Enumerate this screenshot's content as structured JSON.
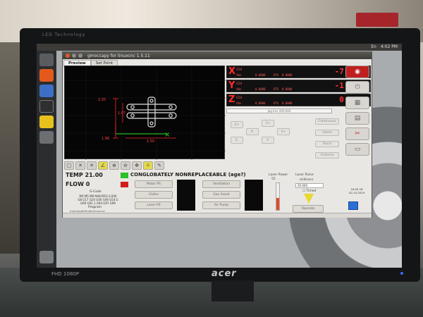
{
  "monitor": {
    "brand": "LED Technology",
    "logo": "acer",
    "badge": "FHD 1080P"
  },
  "topbar": {
    "tray": [
      "En",
      "4:02 PM"
    ]
  },
  "window": {
    "title": "gmoccapy for linuxcnc  1.5.11",
    "title_bar_label": "gmoccapy for linuxcnc  1.5.11"
  },
  "tabs": [
    "Preview",
    "Set Point"
  ],
  "preview": {
    "dim_y": "3.35",
    "dim_side": "1.07",
    "dim_bottom_left": "1.96",
    "dim_bottom": "1.50"
  },
  "dro": {
    "coord_label": "G54",
    "abs_label": "Abs",
    "dtg_label": "DTG",
    "axes": [
      {
        "letter": "X",
        "value": "-7.4832",
        "abs": "0.0000",
        "dtg": "0.0000"
      },
      {
        "letter": "Y",
        "value": "-1.9637",
        "abs": "0.0000",
        "dtg": "0.0000"
      },
      {
        "letter": "Z",
        "value": "0.0000",
        "abs": "0.0000",
        "dtg": "0.0000"
      }
    ]
  },
  "jog": {
    "increment_label": "Jog Incr",
    "speed_value": "200.000",
    "buttons": [
      "X+",
      "X-",
      "Y+",
      "Y-",
      "Z+",
      "Z-"
    ],
    "side_buttons": [
      "Continuous",
      "Home",
      "Touch",
      "Unhome"
    ]
  },
  "status": {
    "temp_label": "TEMP",
    "temp_value": "21.00",
    "temp_color": "#29c12a",
    "flow_label": "FLOW",
    "flow_value": "0",
    "flow_color": "#d21b1b",
    "gcode_title": "G-Code",
    "gcode_line1": "M0 M5 M9 M48 M53  0.000",
    "gcode_line2": "G8 G17 G20 G40 G49 G54 G",
    "gcode_line3": "G90 G91.1 G94 G97 G99",
    "program_title": "Program",
    "program_path": "/home/pathfinder/linuxcnc"
  },
  "banner": "CONGLOBATELY NONREPLACEABLE (age?)",
  "controls": {
    "motor_ps": "Motor PS",
    "chiller": "Chiller",
    "laser_ps": "Laser PS",
    "ventilation": "Ventilation",
    "gas_assist": "Gas Assist",
    "air_pump": "Air Pump"
  },
  "laser": {
    "power_title": "Laser Power",
    "power_value": "55",
    "pulse_title": "Laser Pulse",
    "pulse_unit": "millisecs",
    "pulse_value": "20.000",
    "timed_label": "Timed",
    "operate_label": "Operate",
    "power_fraction": 0.45
  },
  "clock": {
    "time": "16:05:18",
    "date": "02-15-2019"
  },
  "colors": {
    "accent_red": "#ff3030",
    "highlight": "#e4d94a"
  }
}
